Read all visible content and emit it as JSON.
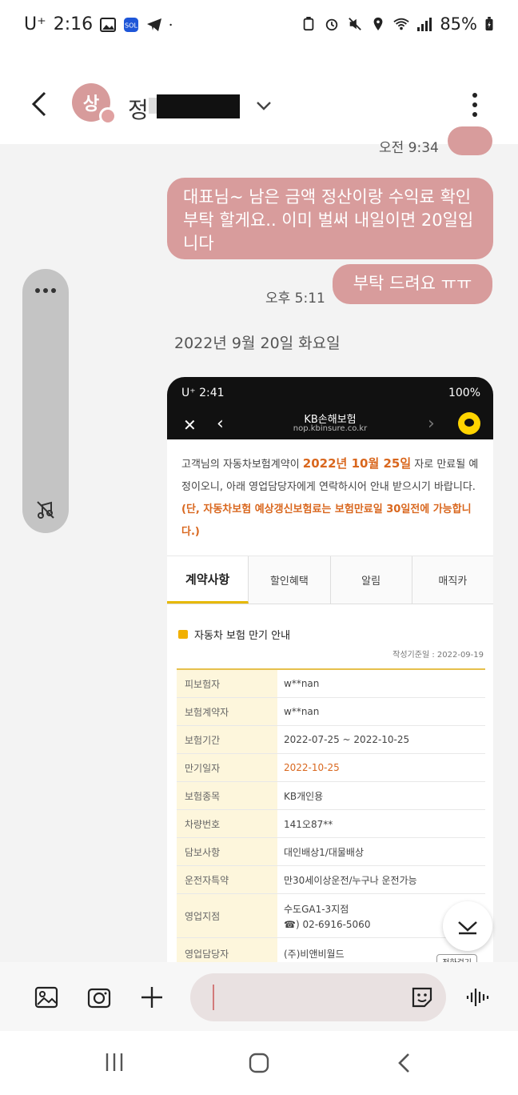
{
  "status_bar": {
    "carrier": "U⁺",
    "time": "2:16",
    "battery": "85%"
  },
  "header": {
    "avatar_initial": "상",
    "contact_name": "정"
  },
  "messages": {
    "prev_time": "오전 9:34",
    "msg1": "대표님~ 남은 금액 정산이랑 수익료 확인 부탁 할게요.. 이미 벌써 내일이면 20일입니다",
    "msg2": "부탁 드려요 ㅠㅠ",
    "msg2_time": "오후 5:11",
    "date_separator": "2022년 9월 20일 화요일"
  },
  "attachment": {
    "status_time": "U⁺ 2:41",
    "status_battery": "100%",
    "page_title": "KB손해보험",
    "page_url": "nop.kbinsure.co.kr",
    "notice_pre": "고객님의 자동차보험계약이 ",
    "notice_date": "2022년 10월 25일",
    "notice_mid": " 자로 만료될 예정이오니, 아래 영업담당자에게 연락하시어 안내 받으시기 바랍니다.",
    "notice_note": "(단, 자동차보험 예상갱신보험료는 보험만료일 30일전에 가능합니다.)",
    "tabs": [
      "계약사항",
      "할인혜택",
      "알림",
      "매직카"
    ],
    "section_title": "자동차 보험 만기 안내",
    "written_date": "작성기준일 : 2022-09-19",
    "rows": [
      {
        "key": "피보험자",
        "value": "w**nan"
      },
      {
        "key": "보험계약자",
        "value": "w**nan"
      },
      {
        "key": "보험기간",
        "value": "2022-07-25 ~ 2022-10-25"
      },
      {
        "key": "만기일자",
        "value": "2022-10-25"
      },
      {
        "key": "보험종목",
        "value": "KB개인용"
      },
      {
        "key": "차량번호",
        "value": "141오87**"
      },
      {
        "key": "담보사항",
        "value": "대인배상1/대물배상"
      },
      {
        "key": "운전자특약",
        "value": "만30세이상운전/누구나 운전가능"
      },
      {
        "key": "영업지점",
        "value": "수도GA1-3지점",
        "value2": "☎) 02-6916-5060"
      },
      {
        "key": "영업담당자",
        "value": "(주)비앤비월드",
        "call": "전화걸기"
      }
    ]
  },
  "composer": {
    "placeholder": ""
  },
  "colors": {
    "bubble": "#d89c9c",
    "accent_orange": "#d9671e",
    "tab_underline": "#e6b800"
  }
}
